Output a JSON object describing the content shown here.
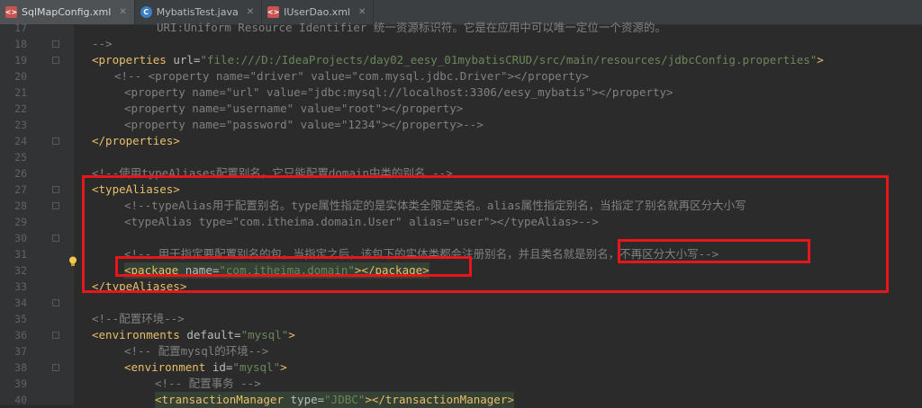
{
  "tabs": [
    {
      "label": "SqlMapConfig.xml",
      "icon": "xml-file-icon",
      "active": true
    },
    {
      "label": "MybatisTest.java",
      "icon": "java-class-icon",
      "active": false
    },
    {
      "label": "IUserDao.xml",
      "icon": "xml-file-icon",
      "active": false
    }
  ],
  "line_numbers": [
    "17",
    "18",
    "19",
    "20",
    "21",
    "22",
    "23",
    "24",
    "25",
    "26",
    "27",
    "28",
    "29",
    "30",
    "31",
    "32",
    "33",
    "34",
    "35",
    "36",
    "37",
    "38",
    "39",
    "40"
  ],
  "code": {
    "l17": "URI:Uniform Resource Identifier 统一资源标识符。它是在应用中可以唯一定位一个资源的。",
    "l18": "-->",
    "l19_tag_open": "<properties",
    "l19_attr": " url=",
    "l19_val": "\"file:///D:/IdeaProjects/day02_eesy_01mybatisCRUD/src/main/resources/jdbcConfig.properties\"",
    "l19_tag_close": ">",
    "l20": "<!-- <property name=\"driver\" value=\"com.mysql.jdbc.Driver\"></property>",
    "l21": "<property name=\"url\" value=\"jdbc:mysql://localhost:3306/eesy_mybatis\"></property>",
    "l22": "<property name=\"username\" value=\"root\"></property>",
    "l23": "<property name=\"password\" value=\"1234\"></property>-->",
    "l24": "</properties>",
    "l26": "<!--使用typeAliases配置别名，它只能配置domain中类的别名 -->",
    "l27": "<typeAliases>",
    "l28": "<!--typeAlias用于配置别名。type属性指定的是实体类全限定类名。alias属性指定别名，当指定了别名就再区分大小写",
    "l29": "<typeAlias type=\"com.itheima.domain.User\" alias=\"user\"></typeAlias>-->",
    "l31": "<!-- 用于指定要配置别名的包，当指定之后，该包下的实体类都会注册别名，并且类名就是别名，不再区分大小写-->",
    "l32_tag_open": "<package",
    "l32_attr": " name=",
    "l32_val": "\"com.itheima.domain\"",
    "l32_tag_close": "></package>",
    "l33": "</typeAliases>",
    "l35": "<!--配置环境-->",
    "l36_tag_open": "<environments",
    "l36_attr": " default=",
    "l36_val": "\"mysql\"",
    "l36_tag_close": ">",
    "l37": "<!-- 配置mysql的环境-->",
    "l38_tag_open": "<environment",
    "l38_attr": " id=",
    "l38_val": "\"mysql\"",
    "l38_tag_close": ">",
    "l39": "<!-- 配置事务 -->",
    "l40_tag_open": "<transactionManager",
    "l40_attr": " type=",
    "l40_val": "\"JDBC\"",
    "l40_tag_close": "></transactionManager>"
  },
  "colors": {
    "background": "#2b2b2b",
    "tag": "#e8bf6a",
    "string": "#6a8759",
    "comment": "#808080",
    "annotation_box": "#e8161b"
  }
}
